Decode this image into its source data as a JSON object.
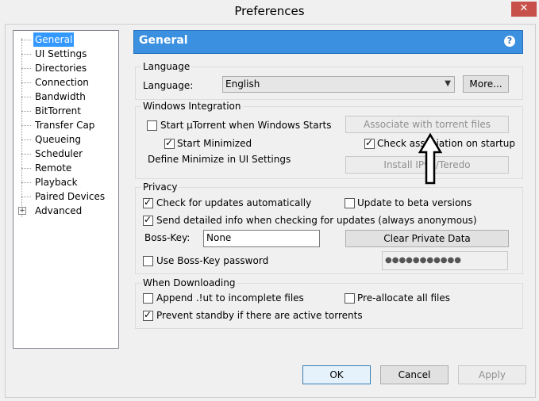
{
  "window": {
    "title": "Preferences",
    "close_glyph": "✕"
  },
  "tree": {
    "items": [
      {
        "label": "General"
      },
      {
        "label": "UI Settings"
      },
      {
        "label": "Directories"
      },
      {
        "label": "Connection"
      },
      {
        "label": "Bandwidth"
      },
      {
        "label": "BitTorrent"
      },
      {
        "label": "Transfer Cap"
      },
      {
        "label": "Queueing"
      },
      {
        "label": "Scheduler"
      },
      {
        "label": "Remote"
      },
      {
        "label": "Playback"
      },
      {
        "label": "Paired Devices"
      },
      {
        "label": "Advanced"
      }
    ],
    "selected": "General",
    "expand_glyph": "+"
  },
  "header": {
    "title": "General",
    "help_glyph": "?",
    "color": "#3b90e0"
  },
  "language": {
    "group_title": "Language",
    "label": "Language:",
    "value": "English",
    "more_button": "More..."
  },
  "windows_integration": {
    "group_title": "Windows Integration",
    "start_with_windows": {
      "label": "Start µTorrent when Windows Starts",
      "checked": false
    },
    "start_minimized": {
      "label": "Start Minimized",
      "checked": true
    },
    "define_minimize": "Define Minimize in UI Settings",
    "associate_button": "Associate with torrent files",
    "check_association": {
      "label": "Check association on startup",
      "checked": true
    },
    "install_teredo_button": "Install IPv6/Teredo"
  },
  "privacy": {
    "group_title": "Privacy",
    "check_updates": {
      "label": "Check for updates automatically",
      "checked": true
    },
    "beta_versions": {
      "label": "Update to beta versions",
      "checked": false
    },
    "send_info": {
      "label": "Send detailed info when checking for updates (always anonymous)",
      "checked": true
    },
    "boss_key_label": "Boss-Key:",
    "boss_key_value": "None",
    "clear_private_button": "Clear Private Data",
    "use_boss_password": {
      "label": "Use Boss-Key password",
      "checked": false
    },
    "password_value": "●●●●●●●●●●●"
  },
  "downloading": {
    "group_title": "When Downloading",
    "append_ut": {
      "label": "Append .!ut to incomplete files",
      "checked": false
    },
    "preallocate": {
      "label": "Pre-allocate all files",
      "checked": false
    },
    "prevent_standby": {
      "label": "Prevent standby if there are active torrents",
      "checked": true
    }
  },
  "footer": {
    "ok": "OK",
    "cancel": "Cancel",
    "apply": "Apply"
  }
}
